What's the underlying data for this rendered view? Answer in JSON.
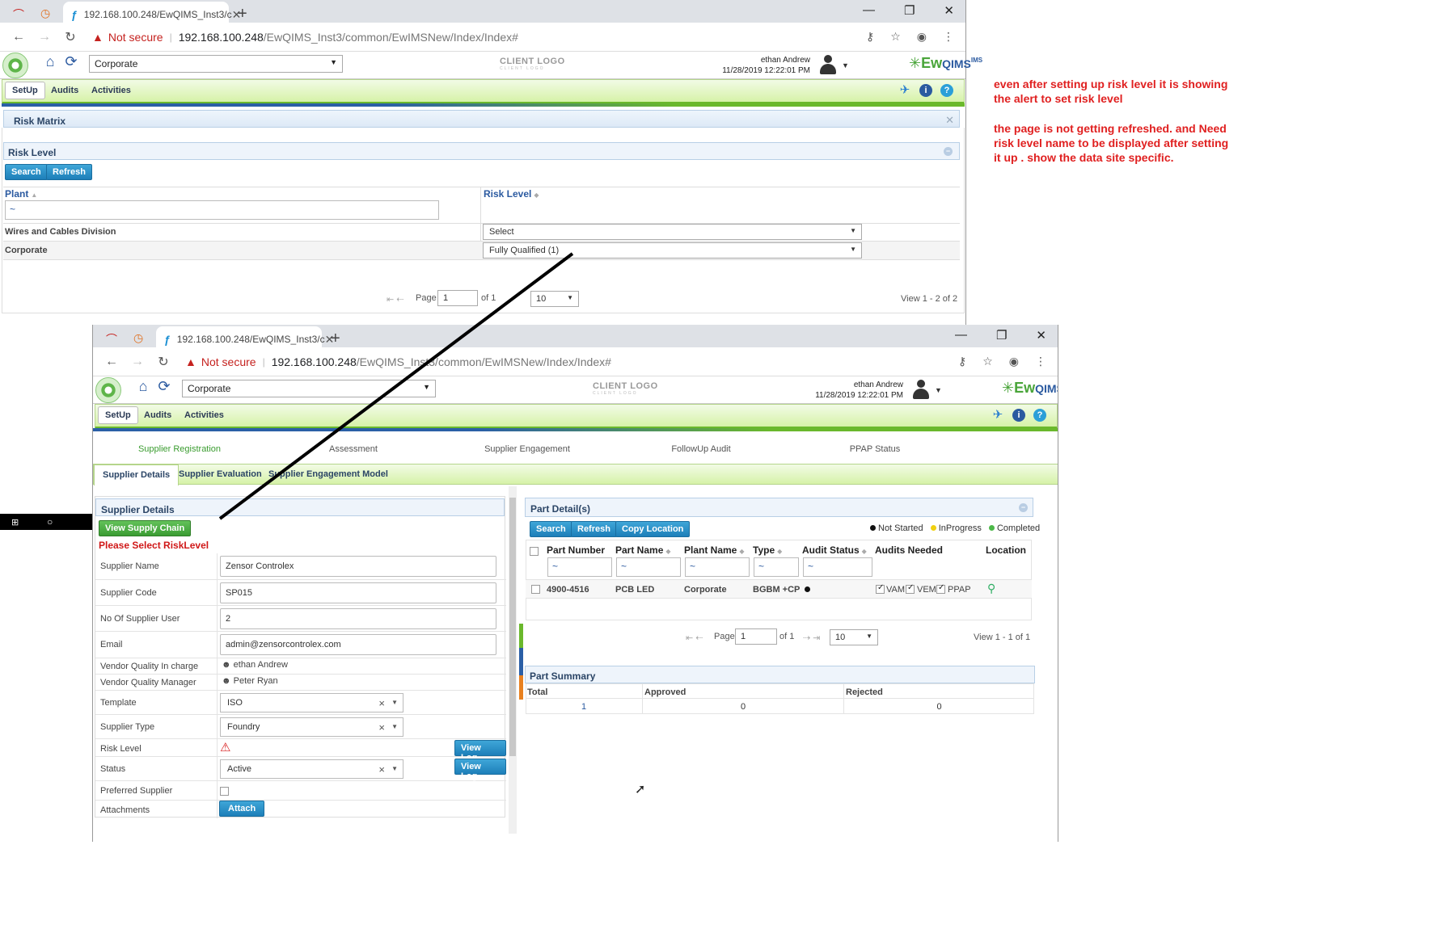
{
  "browser": {
    "tab_title": "192.168.100.248/EwQIMS_Inst3/c",
    "new_tab": "+",
    "not_secure": "Not secure",
    "url_host": "192.168.100.248",
    "url_path": "/EwQIMS_Inst3/common/EwIMSNew/Index/Index#"
  },
  "header": {
    "plant_selected": "Corporate",
    "client_logo": "CLIENT LOGO",
    "client_logo_sub": "CLIENT LOGO",
    "user_name": "ethan Andrew",
    "datetime": "11/28/2019 12:22:01 PM",
    "brand": "Ew",
    "brand_q": "QIMS",
    "brand_sup": "IMS"
  },
  "menu": {
    "setup": "SetUp",
    "audits": "Audits",
    "activities": "Activities"
  },
  "risk_matrix": {
    "title": "Risk Matrix",
    "section_title": "Risk Level",
    "search": "Search",
    "refresh": "Refresh",
    "col_plant": "Plant",
    "col_risk": "Risk Level",
    "filter_value": "~",
    "rows": [
      {
        "plant": "Wires and Cables Division",
        "risk": "Select"
      },
      {
        "plant": "Corporate",
        "risk": "Fully Qualified (1)"
      }
    ],
    "page_label": "Page",
    "page_value": "1",
    "of_label": "of 1",
    "page_size": "10",
    "view_text": "View 1 - 2 of 2"
  },
  "annotation": {
    "line1": "even after setting up risk level it is showing the alert to set risk level",
    "line2": "the page is not getting refreshed. and Need risk level name to be displayed after setting it up . show the data site specific."
  },
  "supplier": {
    "steps": [
      "Supplier Registration",
      "Assessment",
      "Supplier Engagement",
      "FollowUp Audit",
      "PPAP Status"
    ],
    "tabs": [
      "Supplier Details",
      "Supplier Evaluation",
      "Supplier Engagement Model"
    ],
    "section_title": "Supplier Details",
    "view_supply_chain": "View Supply Chain",
    "alert": "Please Select RiskLevel",
    "fields": {
      "name_label": "Supplier Name",
      "name_value": "Zensor Controlex",
      "code_label": "Supplier Code",
      "code_value": "SP015",
      "users_label": "No Of Supplier User",
      "users_value": "2",
      "email_label": "Email",
      "email_value": "admin@zensorcontrolex.com",
      "vq_incharge_label": "Vendor Quality In charge",
      "vq_incharge_value": "ethan Andrew",
      "vq_manager_label": "Vendor Quality Manager",
      "vq_manager_value": "Peter Ryan",
      "template_label": "Template",
      "template_value": "ISO",
      "type_label": "Supplier Type",
      "type_value": "Foundry",
      "risk_label": "Risk Level",
      "status_label": "Status",
      "status_value": "Active",
      "preferred_label": "Preferred Supplier",
      "attachments_label": "Attachments"
    },
    "view_log": "View Log",
    "attach": "Attach",
    "clear_glyph": "×"
  },
  "parts": {
    "title": "Part Detail(s)",
    "search": "Search",
    "refresh": "Refresh",
    "copy_location": "Copy Location",
    "legend": {
      "not_started": "Not Started",
      "in_progress": "InProgress",
      "completed": "Completed"
    },
    "columns": [
      "Part Number",
      "Part Name",
      "Plant Name",
      "Type",
      "Audit Status",
      "Audits Needed",
      "Location"
    ],
    "filter_value": "~",
    "row": {
      "number": "4900-4516",
      "name": "PCB LED",
      "plant": "Corporate",
      "type": "BGBM +CP",
      "audits": [
        "VAM",
        "VEM",
        "PPAP"
      ]
    },
    "page_label": "Page",
    "page_value": "1",
    "of_label": "of 1",
    "page_size": "10",
    "view_text": "View 1 - 1 of 1"
  },
  "summary": {
    "title": "Part Summary",
    "cols": [
      "Total",
      "Approved",
      "Rejected"
    ],
    "values": [
      "1",
      "0",
      "0"
    ]
  },
  "colors": {
    "accent_green": "#6ab82c",
    "accent_blue": "#2a5fa6",
    "alert_red": "#e02020"
  }
}
